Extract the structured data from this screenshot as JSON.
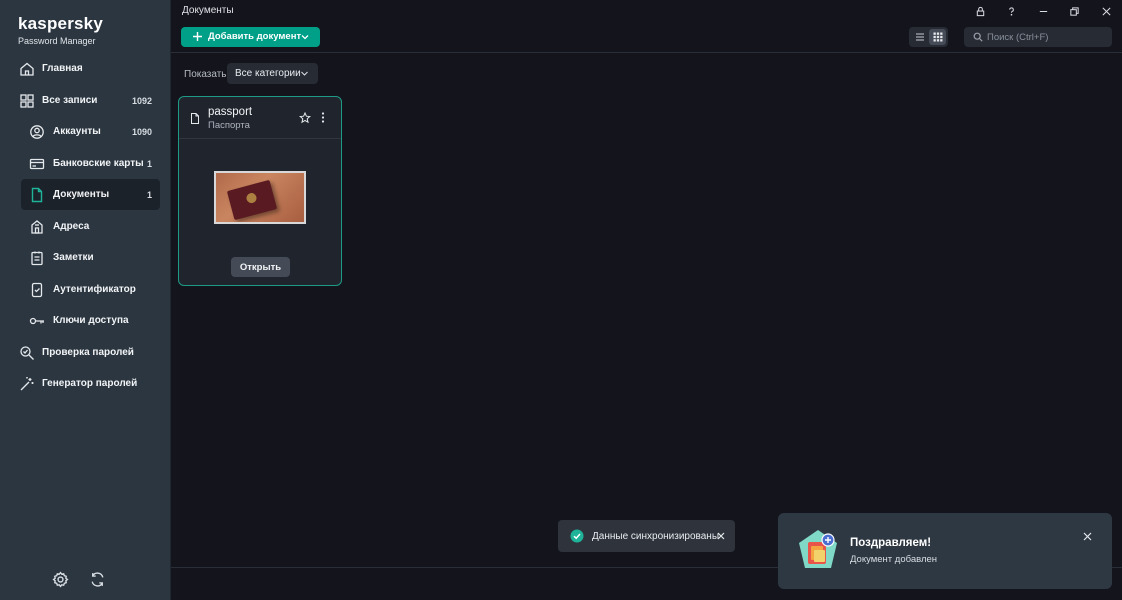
{
  "app": {
    "logo": "kaspersky",
    "logo_subtitle": "Password Manager"
  },
  "sidebar": {
    "items": [
      {
        "label": "Главная",
        "icon": "home-icon",
        "count": ""
      },
      {
        "label": "Все записи",
        "icon": "grid-icon",
        "count": "1092"
      },
      {
        "label": "Аккаунты",
        "icon": "account-icon",
        "count": "1090"
      },
      {
        "label": "Банковские карты",
        "icon": "card-icon",
        "count": "1"
      },
      {
        "label": "Документы",
        "icon": "document-icon",
        "count": "1",
        "active": true
      },
      {
        "label": "Адреса",
        "icon": "address-icon",
        "count": ""
      },
      {
        "label": "Заметки",
        "icon": "notes-icon",
        "count": ""
      },
      {
        "label": "Аутентификатор",
        "icon": "authenticator-icon",
        "count": ""
      },
      {
        "label": "Ключи доступа",
        "icon": "key-icon",
        "count": ""
      },
      {
        "label": "Проверка паролей",
        "icon": "password-check-icon",
        "count": ""
      },
      {
        "label": "Генератор паролей",
        "icon": "password-generator-icon",
        "count": ""
      }
    ],
    "bottom_icons": [
      "settings-icon",
      "sync-icon"
    ]
  },
  "header": {
    "title": "Документы",
    "add_button": "Добавить документ",
    "search_placeholder": "Поиск (Ctrl+F)"
  },
  "filter": {
    "label": "Показать:",
    "value": "Все категории"
  },
  "card": {
    "title": "passport",
    "subtitle": "Паспорта",
    "open_button": "Открыть"
  },
  "sync_toast": {
    "text": "Данные синхронизированы"
  },
  "congrats_toast": {
    "title": "Поздравляем!",
    "text": "Документ добавлен"
  },
  "colors": {
    "accent": "#00a088",
    "sidebar_bg": "#2b3640",
    "main_bg": "#14141c"
  }
}
